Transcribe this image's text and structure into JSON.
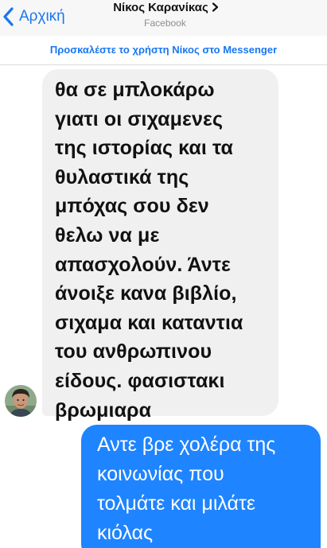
{
  "nav": {
    "back_label": "Αρχική",
    "contact_name": "Νίκος Καρανίκας",
    "subtitle": "Facebook"
  },
  "invite_banner": {
    "text": "Προσκαλέστε το χρήστη Νίκος στο Messenger"
  },
  "messages": [
    {
      "direction": "incoming",
      "text": "θα σε μπλοκάρω\nγιατι οι σιχαμενες\nτης ιστορίας και τα\nθυλαστικά της\nμπόχας σου δεν\nθελω να με\nαπασχολούν. Άντε\nάνοιξε κανα βιβλίο,\nσιχαμα και καταντια\nτου ανθρωπινου\nείδους. φασιστακι\nβρωμιαρα"
    },
    {
      "direction": "outgoing",
      "text": "Αντε βρε χολέρα της\nκοινωνίας που\nτολμάτε και μιλάτε\nκιόλας"
    }
  ],
  "colors": {
    "accent": "#1877f2",
    "outgoing_bubble": "#1f84ff",
    "incoming_bubble": "#f0f0f0",
    "nav_background": "#f7f7f7"
  },
  "icons": {
    "back": "chevron-left-icon",
    "title_disclosure": "chevron-right-icon",
    "avatar": "contact-avatar"
  }
}
